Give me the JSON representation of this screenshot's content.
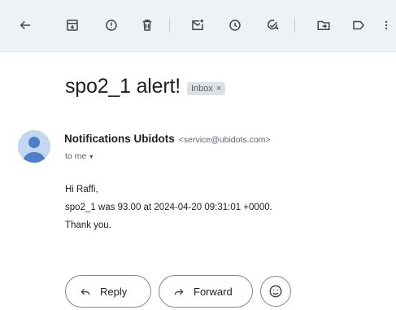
{
  "toolbar": {
    "icons": [
      "back-arrow-icon",
      "archive-icon",
      "report-spam-icon",
      "delete-icon",
      "mark-unread-icon",
      "snooze-icon",
      "add-to-tasks-icon",
      "move-to-icon",
      "label-icon",
      "more-vert-icon"
    ]
  },
  "message": {
    "subject": "spo2_1 alert!",
    "label": "Inbox",
    "label_close": "×",
    "sender_name": "Notifications Ubidots",
    "sender_email": "<service@ubidots.com>",
    "to_label": "to me",
    "caret": "▾",
    "body_lines": [
      "Hi Raffi,",
      "spo2_1 was 93.00 at 2024-04-20 09:31:01 +0000.",
      "Thank you."
    ]
  },
  "actions": {
    "reply_label": "Reply",
    "forward_label": "Forward"
  },
  "colors": {
    "toolbar_bg": "#eef1f6",
    "avatar_bg": "#c4d7f0",
    "avatar_fg": "#4a7fc9"
  }
}
